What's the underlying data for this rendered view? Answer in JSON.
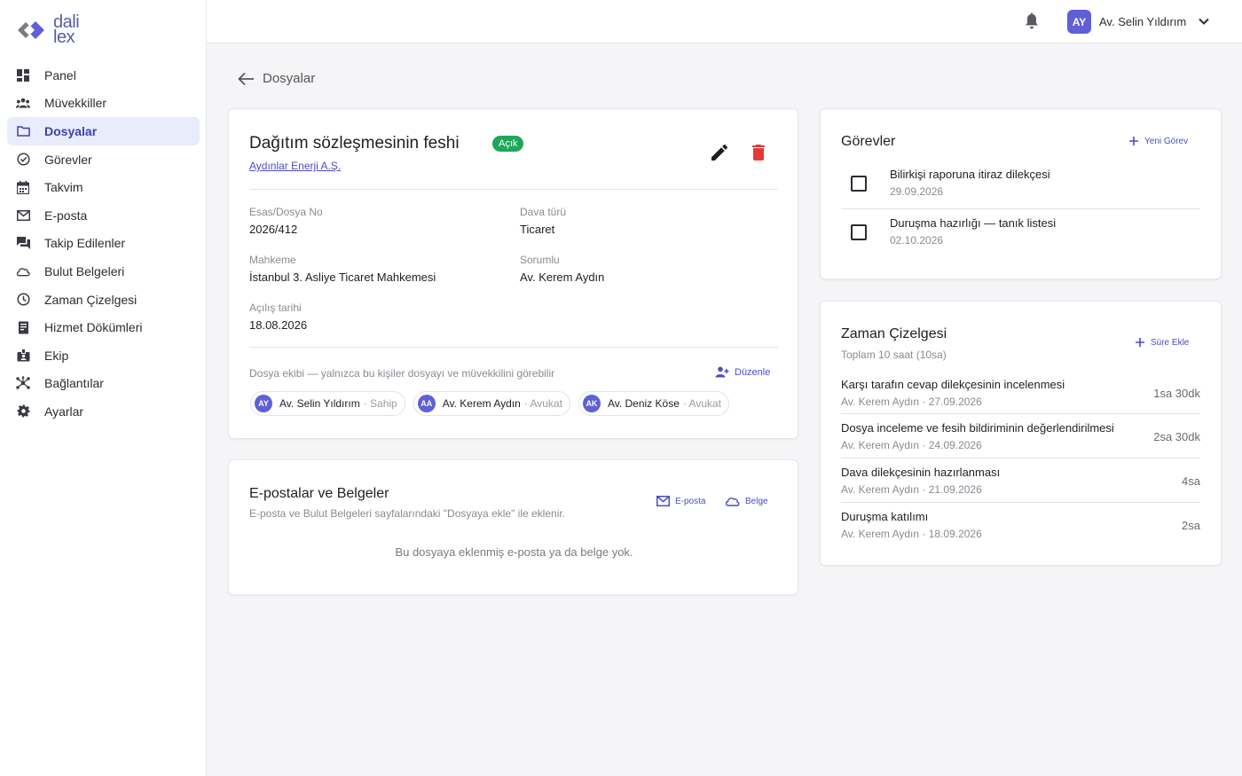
{
  "logo": {
    "line1": "dali",
    "line2": "lex"
  },
  "sidebar": {
    "items": [
      {
        "label": "Panel",
        "icon": "dashboard-icon"
      },
      {
        "label": "Müvekkiller",
        "icon": "people-icon"
      },
      {
        "label": "Dosyalar",
        "icon": "folder-icon",
        "active": true
      },
      {
        "label": "Görevler",
        "icon": "check-circle-icon"
      },
      {
        "label": "Takvim",
        "icon": "calendar-icon"
      },
      {
        "label": "E-posta",
        "icon": "mail-icon"
      },
      {
        "label": "Takip Edilenler",
        "icon": "chat-icon"
      },
      {
        "label": "Bulut Belgeleri",
        "icon": "cloud-icon"
      },
      {
        "label": "Zaman Çizelgesi",
        "icon": "clock-icon"
      },
      {
        "label": "Hizmet Dökümleri",
        "icon": "receipt-icon"
      },
      {
        "label": "Ekip",
        "icon": "badge-icon"
      },
      {
        "label": "Bağlantılar",
        "icon": "hub-icon"
      },
      {
        "label": "Ayarlar",
        "icon": "gear-icon"
      }
    ]
  },
  "topbar": {
    "user_initials": "AY",
    "user_name": "Av. Selin Yıldırım"
  },
  "back_label": "Dosyalar",
  "case": {
    "title": "Dağıtım sözleşmesinin feshi",
    "status": "Açık",
    "client": "Aydınlar Enerji A.Ş.",
    "fields": {
      "case_no_label": "Esas/Dosya No",
      "case_no": "2026/412",
      "type_label": "Dava türü",
      "type": "Ticaret",
      "court_label": "Mahkeme",
      "court": "İstanbul 3. Asliye Ticaret Mahkemesi",
      "owner_label": "Sorumlu",
      "owner": "Av. Kerem Aydın",
      "opened_label": "Açılış tarihi",
      "opened": "18.08.2026"
    },
    "team_note": "Dosya ekibi — yalnızca bu kişiler dosyayı ve müvekkilini görebilir",
    "team_edit": "Düzenle",
    "team": [
      {
        "initials": "AY",
        "name": "Av. Selin Yıldırım",
        "role": "· Sahip"
      },
      {
        "initials": "AA",
        "name": "Av. Kerem Aydın",
        "role": "· Avukat"
      },
      {
        "initials": "AK",
        "name": "Av. Deniz Köse",
        "role": "· Avukat"
      }
    ]
  },
  "mail": {
    "title": "E-postalar ve Belgeler",
    "subtitle": "E-posta ve Bulut Belgeleri sayfalarındaki \"Dosyaya ekle\" ile eklenir.",
    "email_action": "E-posta",
    "doc_action": "Belge",
    "empty": "Bu dosyaya eklenmiş e-posta ya da belge yok."
  },
  "tasks": {
    "title": "Görevler",
    "new_label": "Yeni Görev",
    "items": [
      {
        "title": "Bilirkişi raporuna itiraz dilekçesi",
        "date": "29.09.2026"
      },
      {
        "title": "Duruşma hazırlığı — tanık listesi",
        "date": "02.10.2026"
      }
    ]
  },
  "timesheet": {
    "title": "Zaman Çizelgesi",
    "total": "Toplam 10 saat (10sa)",
    "add_label": "Süre Ekle",
    "entries": [
      {
        "title": "Karşı tarafın cevap dilekçesinin incelenmesi",
        "sub": "Av. Kerem Aydın · 27.09.2026",
        "hours": "1sa 30dk"
      },
      {
        "title": "Dosya inceleme ve fesih bildiriminin değerlendirilmesi",
        "sub": "Av. Kerem Aydın · 24.09.2026",
        "hours": "2sa 30dk"
      },
      {
        "title": "Dava dilekçesinin hazırlanması",
        "sub": "Av. Kerem Aydın · 21.09.2026",
        "hours": "4sa"
      },
      {
        "title": "Duruşma katılımı",
        "sub": "Av. Kerem Aydın · 18.09.2026",
        "hours": "2sa"
      }
    ]
  },
  "colors": {
    "accent": "#5f5fd6",
    "status_green": "#1fa65a",
    "danger": "#e53935"
  }
}
